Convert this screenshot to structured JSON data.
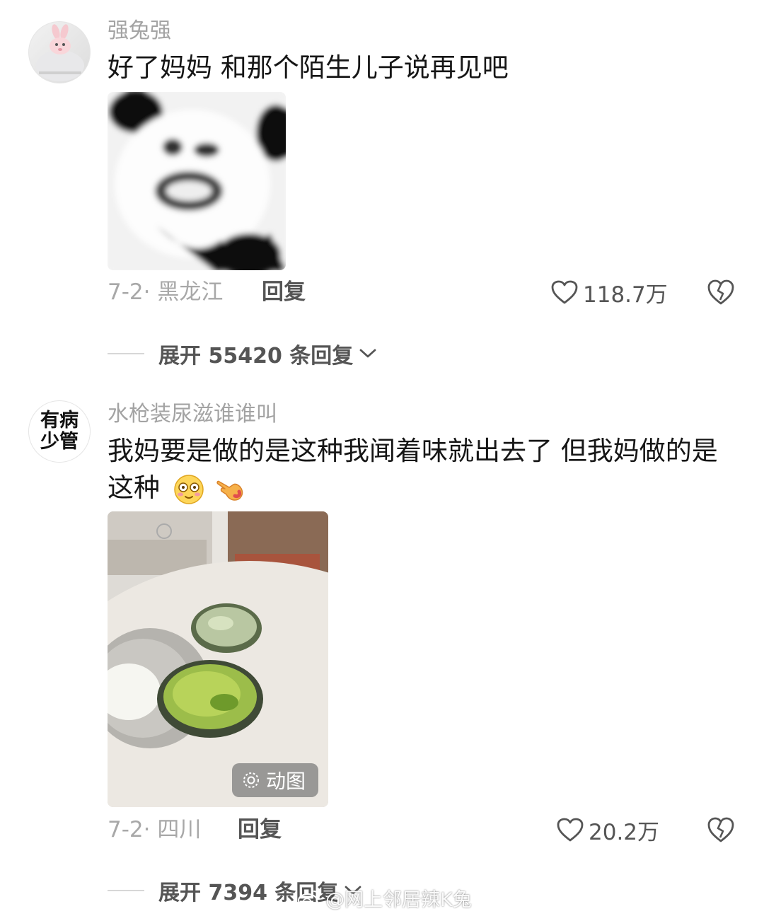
{
  "comments": [
    {
      "username": "强兔强",
      "text": "好了妈妈 和那个陌生儿子说再见吧",
      "date": "7-2· 黑龙江",
      "reply_label": "回复",
      "likes": "118.7万",
      "expand_label": "展开 55420 条回复"
    },
    {
      "username": "水枪装尿滋谁谁叫",
      "avatar_text": "有病\n少管",
      "text": "我妈要是做的是这种我闻着味就出去了 但我妈做的是这种",
      "gif_label": "动图",
      "date": "7-2· 四川",
      "reply_label": "回复",
      "likes": "20.2万",
      "expand_label": "展开 7394 条回复"
    }
  ],
  "watermark": "@网上邻居辣K兔",
  "colors": {
    "username": "#a3a3a3",
    "text": "#161616",
    "meta": "#a8a8a8",
    "action": "#555555"
  },
  "icons": [
    "heart-outline-icon",
    "broken-heart-icon",
    "chevron-down-icon",
    "gif-icon",
    "weibo-icon",
    "flushed-face-emoji",
    "pointing-hand-emoji"
  ]
}
